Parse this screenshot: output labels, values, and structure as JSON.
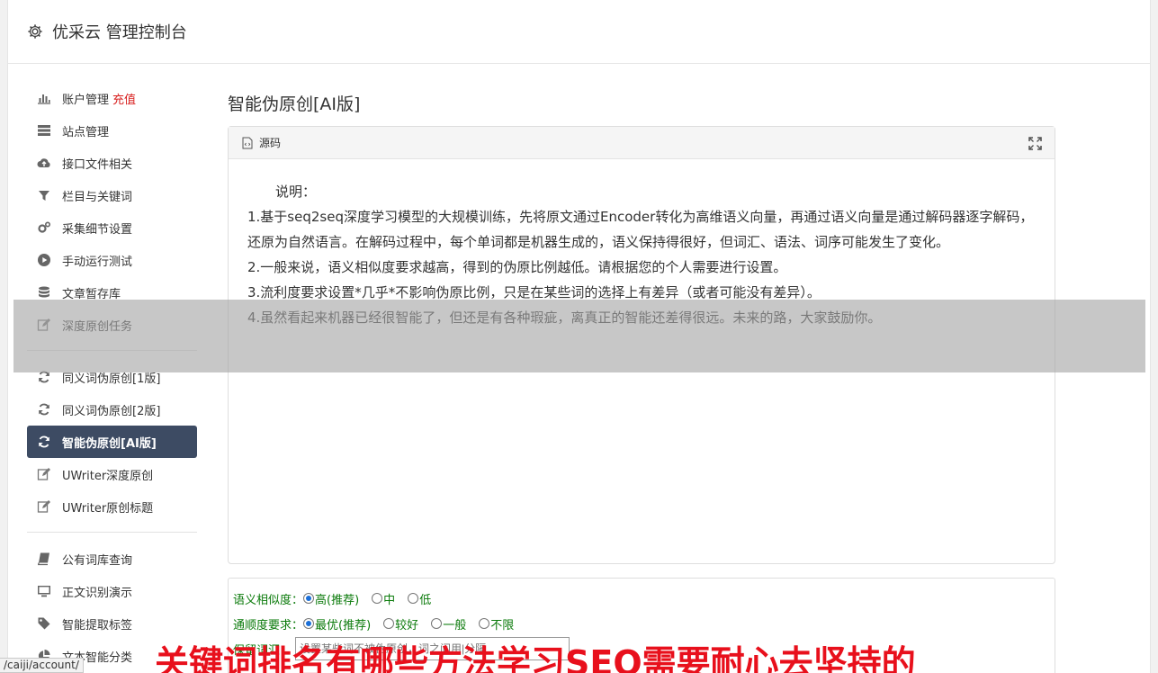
{
  "header": {
    "title": "优采云 管理控制台",
    "icon": "gear-icon"
  },
  "sidebar": {
    "group1": [
      {
        "label": "账户管理",
        "extra": "充值",
        "icon": "bar-chart-icon"
      },
      {
        "label": "站点管理",
        "icon": "server-icon"
      },
      {
        "label": "接口文件相关",
        "icon": "cloud-upload-icon"
      },
      {
        "label": "栏目与关键词",
        "icon": "filter-icon"
      },
      {
        "label": "采集细节设置",
        "icon": "gears-icon"
      },
      {
        "label": "手动运行测试",
        "icon": "play-icon"
      },
      {
        "label": "文章暂存库",
        "icon": "database-icon"
      },
      {
        "label": "深度原创任务",
        "icon": "edit-icon"
      }
    ],
    "group2": [
      {
        "label": "同义词伪原创[1版]",
        "icon": "refresh-icon"
      },
      {
        "label": "同义词伪原创[2版]",
        "icon": "refresh-icon"
      },
      {
        "label": "智能伪原创[AI版]",
        "icon": "refresh-icon",
        "active": true
      },
      {
        "label": "UWriter深度原创",
        "icon": "edit-icon"
      },
      {
        "label": "UWriter原创标题",
        "icon": "edit-icon"
      }
    ],
    "group3": [
      {
        "label": "公有词库查询",
        "icon": "book-icon"
      },
      {
        "label": "正文识别演示",
        "icon": "monitor-icon"
      },
      {
        "label": "智能提取标签",
        "icon": "tag-icon"
      },
      {
        "label": "文本智能分类",
        "icon": "pie-chart-icon"
      }
    ]
  },
  "main": {
    "title": "智能伪原创[AI版]",
    "panel": {
      "header": "源码",
      "intro": "说明：",
      "lines": [
        "1.基于seq2seq深度学习模型的大规模训练，先将原文通过Encoder转化为高维语义向量，再通过语义向量是通过解码器逐字解码，还原为自然语言。在解码过程中，每个单词都是机器生成的，语义保持得很好，但词汇、语法、词序可能发生了变化。",
        "2.一般来说，语义相似度要求越高，得到的伪原比例越低。请根据您的个人需要进行设置。",
        "3.流利度要求设置*几乎*不影响伪原比例，只是在某些词的选择上有差异（或者可能没有差异）。",
        "4.虽然看起来机器已经很智能了，但还是有各种瑕疵，离真正的智能还差得很远。未来的路，大家鼓励你。"
      ]
    },
    "options": {
      "similarity": {
        "label": "语义相似度：",
        "choices": [
          "高(推荐)",
          "中",
          "低"
        ],
        "selected": 0
      },
      "fluency": {
        "label": "通顺度要求：",
        "choices": [
          "最优(推荐)",
          "较好",
          "一般",
          "不限"
        ],
        "selected": 0
      },
      "keep_words": {
        "label": "保留词汇：",
        "placeholder": "设置某些词不被伪原创，词之间用|分隔"
      }
    }
  },
  "banner": "关键词排名有哪些方法学习SEO需要耐心去坚持的",
  "statusbar": "/caiji/account/"
}
